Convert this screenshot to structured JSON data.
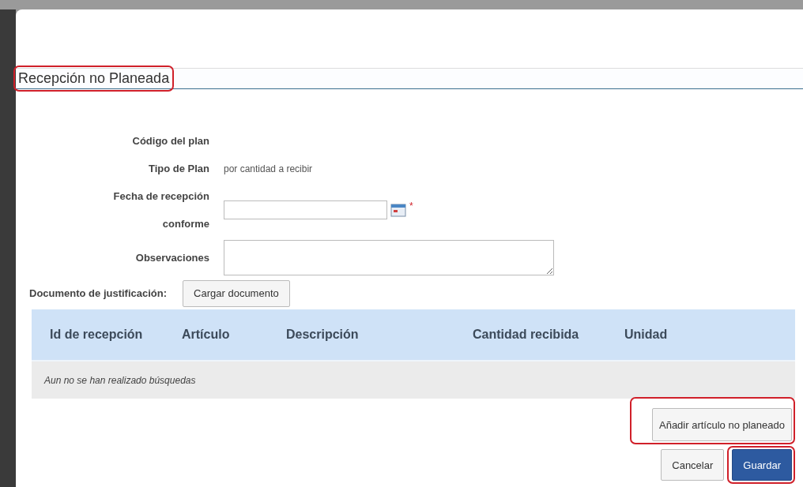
{
  "dialog": {
    "title": "Recepción no Planeada",
    "title_highlighted": true
  },
  "form": {
    "fields": [
      {
        "kind": "text",
        "label": "Código del plan"
      },
      {
        "kind": "text",
        "label": "Tipo de Plan",
        "value": "por cantidad a recibir"
      },
      {
        "kind": "date",
        "label": "Fecha de recepción conforme",
        "required_mark": "*"
      },
      {
        "kind": "textarea",
        "label": "Observaciones"
      }
    ],
    "upload": {
      "label": "Documento de justificación:",
      "button": "Cargar documento"
    }
  },
  "table": {
    "columns": [
      "Id de recepción",
      "Artículo",
      "Descripción",
      "Cantidad recibida",
      "Unidad"
    ],
    "empty_message": "Aun no se han realizado búsquedas"
  },
  "buttons": [
    {
      "kind": "secondary",
      "label": "Añadir artículo no planeado",
      "highlighted": true
    },
    {
      "kind": "secondary",
      "label": "Cancelar",
      "highlighted": false
    },
    {
      "kind": "primary",
      "label": "Guardar",
      "highlighted": true
    }
  ]
}
